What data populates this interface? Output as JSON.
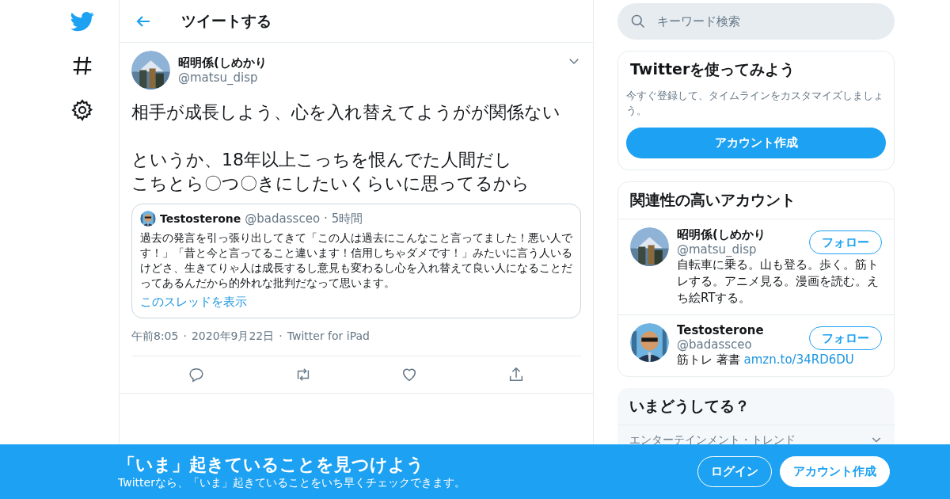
{
  "header": {
    "title": "ツイートする"
  },
  "tweet": {
    "author": {
      "name": "昭明係(しめかり",
      "handle": "@matsu_disp"
    },
    "text_lines": [
      "相手が成長しよう、心を入れ替えてようがが関係ない",
      "というか、18年以上こっちを恨んでた人間だし",
      "こちとら〇つ〇きにしたいくらいに思ってるから"
    ],
    "quote": {
      "name": "Testosterone",
      "handle": "@badassceo",
      "separator": "·",
      "time": "5時間",
      "text": "過去の発言を引っ張り出してきて「この人は過去にこんなこと言ってました！悪い人です！」「昔と今と言ってること違います！信用しちゃダメです！」みたいに言う人いるけどさ、生きてりゃ人は成長するし意見も変わるし心を入れ替えて良い人になることだってあるんだから的外れな批判だなって思います。",
      "link": "このスレッドを表示"
    },
    "meta": [
      "午前8:05",
      "2020年9月22日",
      "Twitter for iPad"
    ],
    "meta_separator": "·"
  },
  "search": {
    "placeholder": "キーワード検索"
  },
  "signup_card": {
    "title": "Twitterを使ってみよう",
    "text": "今すぐ登録して、タイムラインをカスタマイズしましょう。",
    "button": "アカウント作成"
  },
  "related": {
    "title": "関連性の高いアカウント",
    "accounts": [
      {
        "name": "昭明係(しめかり",
        "handle": "@matsu_disp",
        "bio": "自転車に乗る。山も登る。歩く。筋トレする。アニメ見る。漫画を読む。えち絵RTする。",
        "button": "フォロー"
      },
      {
        "name": "Testosterone",
        "handle": "@badassceo",
        "bio": "筋トレ 著書",
        "link": "amzn.to/34RD6DU",
        "button": "フォロー"
      }
    ]
  },
  "trends": {
    "title": "いまどうしてる？",
    "first_item": "エンターテインメント・トレンド"
  },
  "banner": {
    "title": "「いま」起きていることを見つけよう",
    "subtitle": "Twitterなら、「いま」起きていることをいち早くチェックできます。",
    "buttons": [
      {
        "label": "ログイン",
        "kind": "outline"
      },
      {
        "label": "アカウント作成",
        "kind": "filled"
      }
    ]
  }
}
